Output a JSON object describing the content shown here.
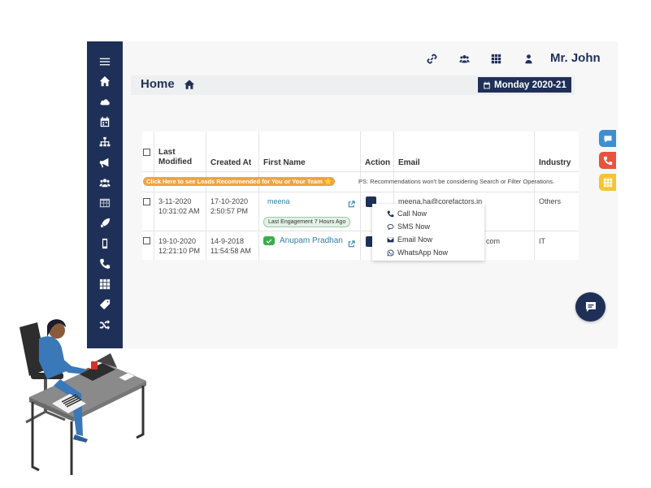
{
  "topbar": {
    "user_name": "Mr. John",
    "icons": [
      "link-icon",
      "users-icon",
      "grid-icon",
      "user-icon"
    ]
  },
  "sidebar": {
    "icons": [
      "menu-icon",
      "home-icon",
      "cloud-icon",
      "calendar-icon",
      "sitemap-icon",
      "bullhorn-icon",
      "users-icon",
      "table-icon",
      "rocket-icon",
      "mobile-icon",
      "phone-icon",
      "grid-icon",
      "tag-icon",
      "shuffle-icon"
    ]
  },
  "page": {
    "title": "Home",
    "date_badge": "Monday 2020-21"
  },
  "table": {
    "headers": {
      "last_modified": "Last Modified",
      "created_at": "Created At",
      "first_name": "First Name",
      "action": "Action",
      "email": "Email",
      "industry": "Industry"
    },
    "recommend_button": "Click Here to see Leads Recommended for You or Your Team ⭐",
    "recommend_note": "PS: Recommendations won't be considering Search or Filter Operations.",
    "rows": [
      {
        "last_modified_date": "3-11-2020",
        "last_modified_time": "10:31:02 AM",
        "created_date": "17-10-2020",
        "created_time": "2:50:57 PM",
        "first_name": "meena",
        "engagement": "Last Engagement 7 Hours Ago",
        "email": "meena.ha@corefactors.in",
        "industry": "Others"
      },
      {
        "last_modified_date": "19-10-2020",
        "last_modified_time": "12:21:10 PM",
        "created_date": "14-9-2018",
        "created_time": "11:54:58 AM",
        "first_name": "Anupam Pradhan",
        "email": "com",
        "industry": "IT"
      }
    ]
  },
  "action_menu": {
    "call": "Call Now",
    "sms": "SMS Now",
    "email": "Email Now",
    "whatsapp": "WhatsApp Now"
  },
  "colors": {
    "brand_navy": "#1f3058",
    "feedback": "#3d8fd1",
    "phone": "#e8533d",
    "apps": "#f5c531",
    "recommend": "#f4a23d",
    "link": "#2f7fa8"
  }
}
